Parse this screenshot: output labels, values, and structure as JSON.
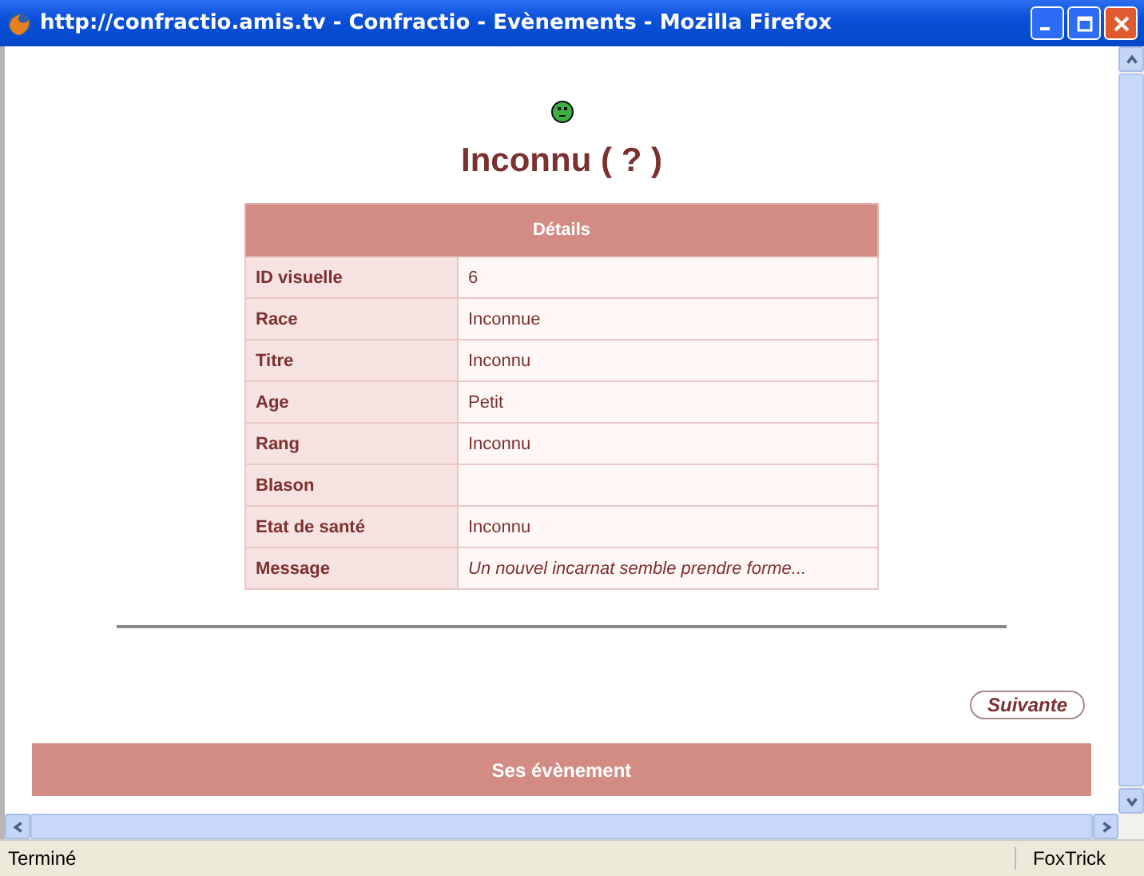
{
  "window": {
    "title": "http://confractio.amis.tv - Confractio - Evènements - Mozilla Firefox"
  },
  "page": {
    "heading": "Inconnu ( ? )",
    "details": {
      "header": "Détails",
      "rows": [
        {
          "label": "ID visuelle",
          "value": "6"
        },
        {
          "label": "Race",
          "value": "Inconnue"
        },
        {
          "label": "Titre",
          "value": "Inconnu"
        },
        {
          "label": "Age",
          "value": "Petit"
        },
        {
          "label": "Rang",
          "value": "Inconnu"
        },
        {
          "label": "Blason",
          "value": ""
        },
        {
          "label": "Etat de santé",
          "value": "Inconnu"
        },
        {
          "label": "Message",
          "value": "Un nouvel incarnat semble prendre forme...",
          "italic": true
        }
      ]
    },
    "next_button": "Suivante",
    "events": {
      "header": "Ses évènement"
    }
  },
  "status_bar": {
    "text": "Terminé",
    "addon": "FoxTrick"
  }
}
